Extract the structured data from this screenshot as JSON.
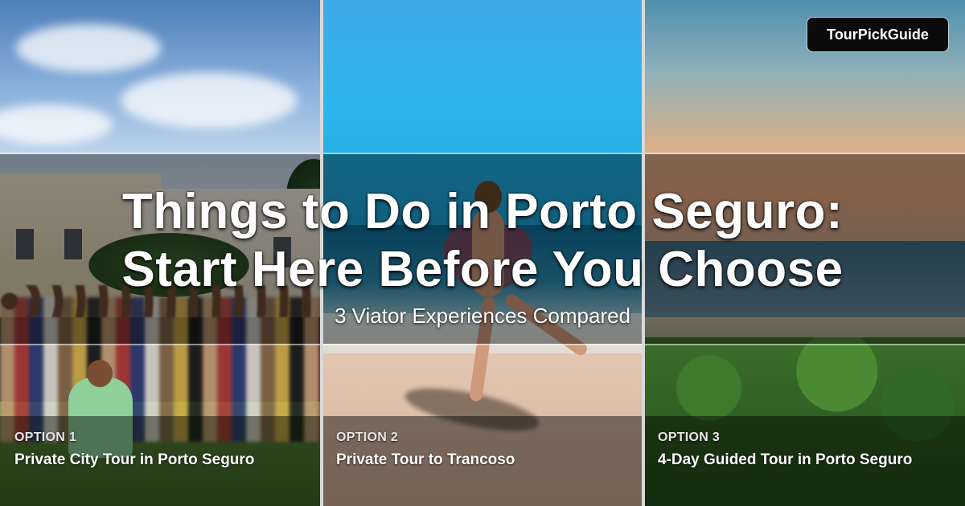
{
  "brand": {
    "label": "TourPickGuide"
  },
  "headline": {
    "line1": "Things to Do in Porto Seguro:",
    "line2": "Start Here Before You Choose",
    "subtitle": "3 Viator Experiences Compared"
  },
  "options": [
    {
      "label": "OPTION 1",
      "title": "Private City Tour in Porto Seguro"
    },
    {
      "label": "OPTION 2",
      "title": "Private Tour to Trancoso"
    },
    {
      "label": "OPTION 3",
      "title": "4-Day Guided Tour in Porto Seguro"
    }
  ],
  "colors": {
    "band_overlay": "#000000",
    "brand_bg": "#0b0b0b",
    "text": "#ffffff",
    "divider": "#d9d9d9"
  }
}
